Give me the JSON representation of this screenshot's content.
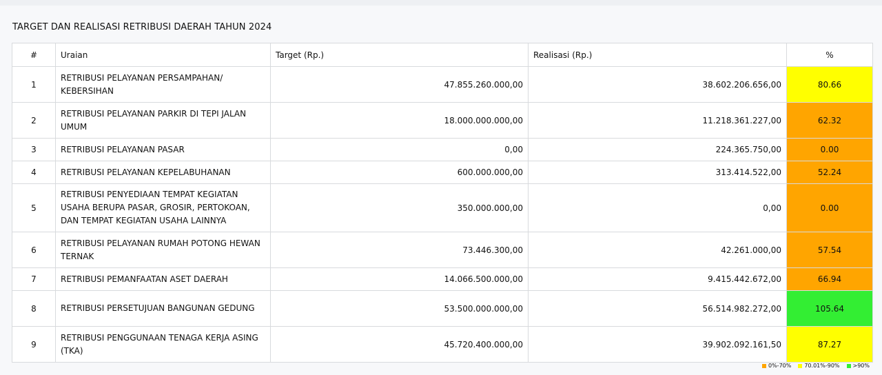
{
  "title": "TARGET DAN REALISASI RETRIBUSI DAERAH TAHUN 2024",
  "headers": {
    "no": "#",
    "uraian": "Uraian",
    "target": "Target (Rp.)",
    "realisasi": "Realisasi (Rp.)",
    "pct": "%"
  },
  "colors": {
    "low": "#ffa500",
    "mid": "#ffff00",
    "high": "#33ee33"
  },
  "rows": [
    {
      "no": "1",
      "uraian": "RETRIBUSI PELAYANAN PERSAMPAHAN/ KEBERSIHAN",
      "target": "47.855.260.000,00",
      "realisasi": "38.602.206.656,00",
      "pct": "80.66",
      "level": "mid"
    },
    {
      "no": "2",
      "uraian": "RETRIBUSI PELAYANAN PARKIR DI TEPI JALAN UMUM",
      "target": "18.000.000.000,00",
      "realisasi": "11.218.361.227,00",
      "pct": "62.32",
      "level": "low"
    },
    {
      "no": "3",
      "uraian": "RETRIBUSI PELAYANAN PASAR",
      "target": "0,00",
      "realisasi": "224.365.750,00",
      "pct": "0.00",
      "level": "low"
    },
    {
      "no": "4",
      "uraian": "RETRIBUSI PELAYANAN KEPELABUHANAN",
      "target": "600.000.000,00",
      "realisasi": "313.414.522,00",
      "pct": "52.24",
      "level": "low"
    },
    {
      "no": "5",
      "uraian": "RETRIBUSI PENYEDIAAN TEMPAT KEGIATAN USAHA BERUPA PASAR, GROSIR, PERTOKOAN, DAN TEMPAT KEGIATAN USAHA LAINNYA",
      "target": "350.000.000,00",
      "realisasi": "0,00",
      "pct": "0.00",
      "level": "low"
    },
    {
      "no": "6",
      "uraian": "RETRIBUSI PELAYANAN RUMAH POTONG HEWAN TERNAK",
      "target": "73.446.300,00",
      "realisasi": "42.261.000,00",
      "pct": "57.54",
      "level": "low"
    },
    {
      "no": "7",
      "uraian": "RETRIBUSI PEMANFAATAN ASET DAERAH",
      "target": "14.066.500.000,00",
      "realisasi": "9.415.442.672,00",
      "pct": "66.94",
      "level": "low"
    },
    {
      "no": "8",
      "uraian": "RETRIBUSI PERSETUJUAN BANGUNAN GEDUNG",
      "target": "53.500.000.000,00",
      "realisasi": "56.514.982.272,00",
      "pct": "105.64",
      "level": "high"
    },
    {
      "no": "9",
      "uraian": "RETRIBUSI PENGGUNAAN TENAGA KERJA ASING (TKA)",
      "target": "45.720.400.000,00",
      "realisasi": "39.902.092.161,50",
      "pct": "87.27",
      "level": "mid"
    }
  ],
  "legend": [
    {
      "label": "0%-70%",
      "level": "low"
    },
    {
      "label": "70.01%-90%",
      "level": "mid"
    },
    {
      "label": ">90%",
      "level": "high"
    }
  ]
}
